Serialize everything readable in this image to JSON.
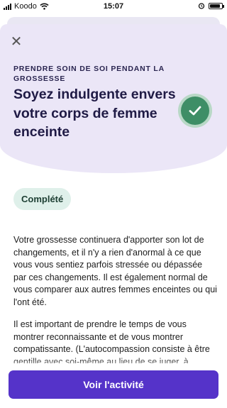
{
  "status_bar": {
    "carrier": "Koodo",
    "time": "15:07"
  },
  "header": {
    "eyebrow": "PRENDRE SOIN DE SOI PENDANT LA GROSSESSE",
    "title": "Soyez indulgente envers votre corps de femme enceinte",
    "completion_icon": "checkmark-icon",
    "close_icon": "close-icon"
  },
  "badge": {
    "label": "Complété"
  },
  "content": {
    "paragraphs": [
      "Votre grossesse continuera d'apporter son lot de changements, et il n'y a rien d'anormal à ce que vous vous sentiez parfois stressée ou dépassée par ces changements. Il est également normal de vous comparer aux autres femmes enceintes ou qui l'ont été.",
      "Il est important de prendre le temps de vous montrer reconnaissante et de vous montrer compatissante. (L'autocompassion consiste à être gentille avec soi-même au lieu de se juger, à"
    ]
  },
  "cta": {
    "label": "Voir l'activité"
  },
  "colors": {
    "accent": "#5533c9",
    "hero_bg": "#ebe6f7",
    "success": "#3e8e66",
    "badge_bg": "#dff0ea"
  }
}
